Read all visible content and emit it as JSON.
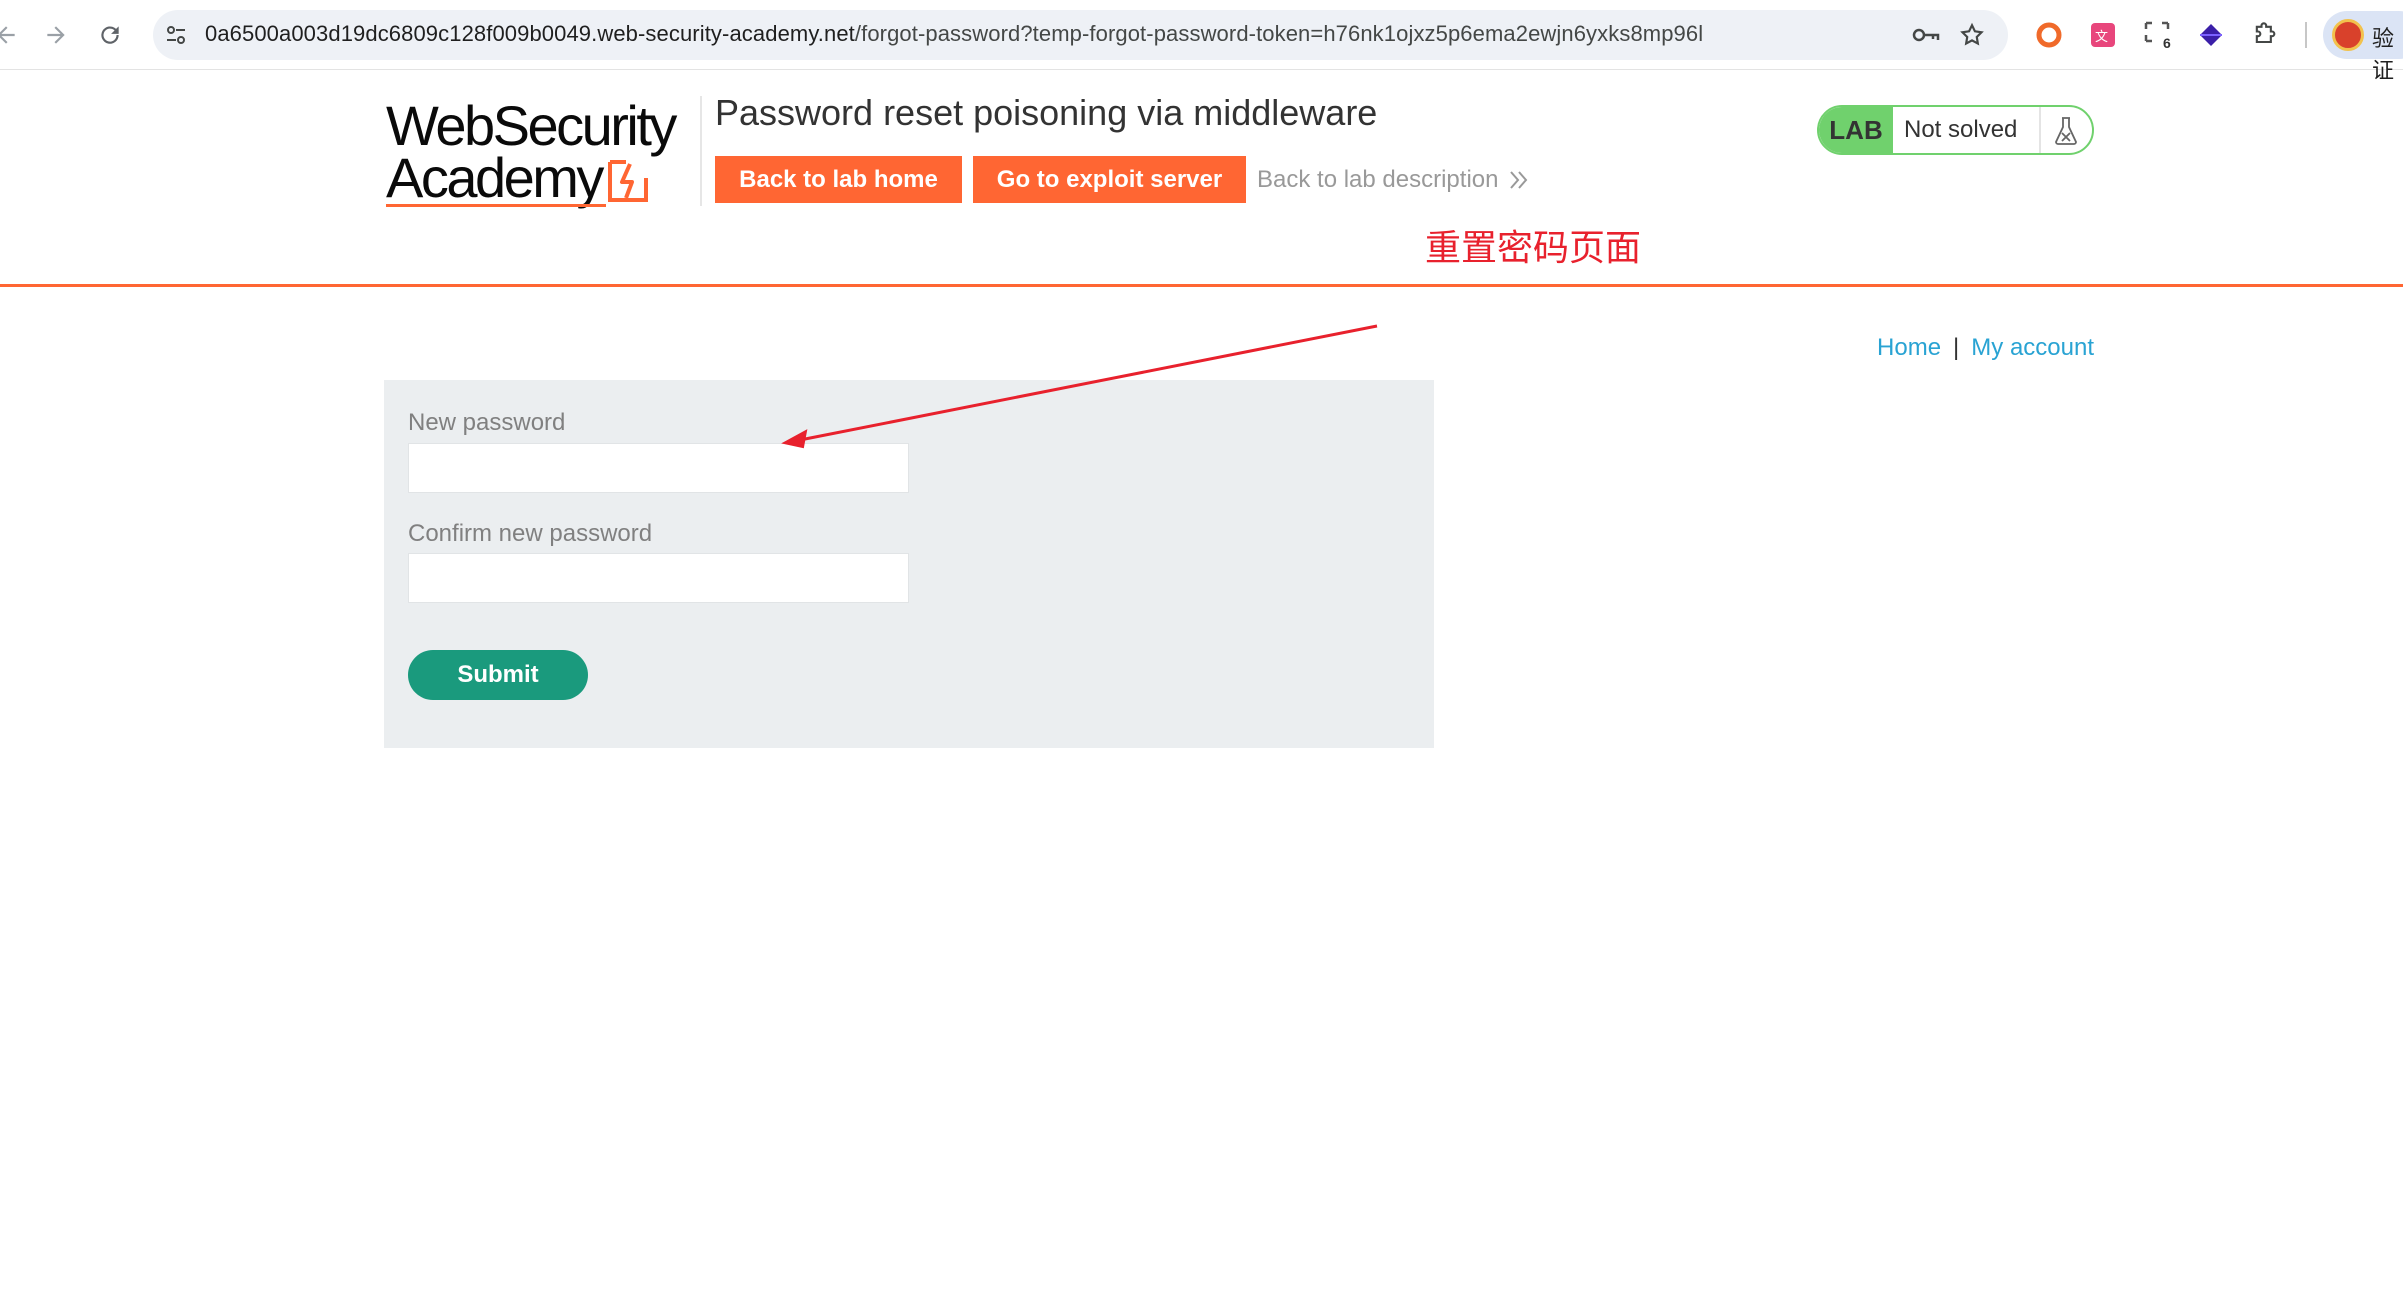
{
  "browser": {
    "url_host": "0a6500a003d19dc6809c128f009b0049.web-security-academy.net",
    "url_path": "/forgot-password?temp-forgot-password-token=h76nk1ojxz5p6ema2ewjn6yxks8mp96l",
    "profile_label": "验证",
    "extension_badge": "6",
    "icons": {
      "back": "back-arrow-icon",
      "forward": "forward-arrow-icon",
      "reload": "reload-icon",
      "site_info": "tune-icon",
      "password_key": "key-icon",
      "bookmark": "star-icon",
      "extensions": "puzzle-icon"
    }
  },
  "logo": {
    "line1": "WebSecurity",
    "line2": "Academy"
  },
  "header": {
    "lab_title": "Password reset poisoning via middleware",
    "back_to_lab_home": "Back to lab home",
    "go_to_exploit_server": "Go to exploit server",
    "back_to_lab_description": "Back to lab description"
  },
  "lab_status": {
    "badge": "LAB",
    "status": "Not solved"
  },
  "annotation": {
    "text": "重置密码页面",
    "color": "#e8212d"
  },
  "nav": {
    "home": "Home",
    "separator": "|",
    "my_account": "My account"
  },
  "form": {
    "new_password_label": "New password",
    "new_password_value": "",
    "confirm_password_label": "Confirm new password",
    "confirm_password_value": "",
    "submit_label": "Submit"
  },
  "colors": {
    "brand_orange": "#ff6633",
    "lab_green": "#70d16d",
    "submit_green": "#1a9a7d",
    "link_blue": "#29a3d3",
    "panel_gray": "#ebeef0"
  }
}
